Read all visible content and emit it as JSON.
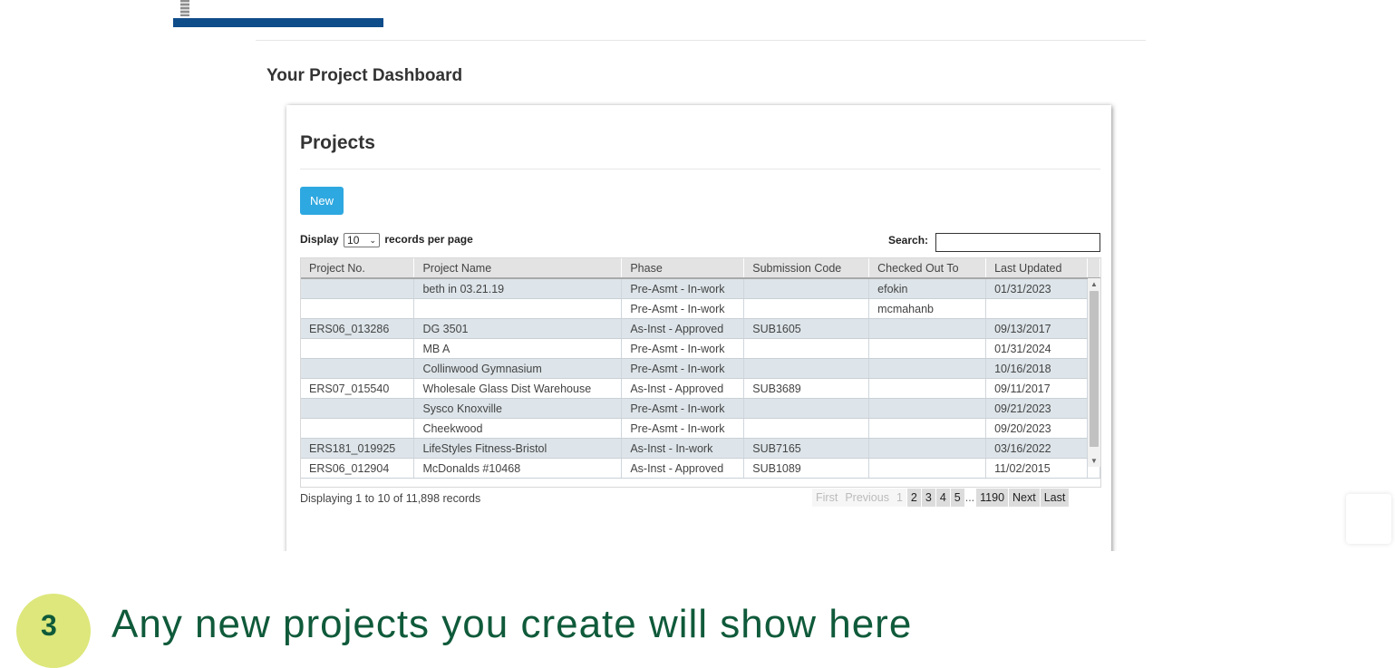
{
  "page_title": "Your Project Dashboard",
  "panel": {
    "title": "Projects",
    "new_label": "New",
    "display_prefix": "Display",
    "records_per_page": "10",
    "display_suffix": "records per page",
    "search_label": "Search:",
    "search_value": ""
  },
  "table": {
    "columns": [
      "Project No.",
      "Project Name",
      "Phase",
      "Submission Code",
      "Checked Out To",
      "Last Updated"
    ],
    "rows": [
      [
        "",
        "beth in 03.21.19",
        "Pre-Asmt - In-work",
        "",
        "efokin",
        "01/31/2023"
      ],
      [
        "",
        "",
        "Pre-Asmt - In-work",
        "",
        "mcmahanb",
        ""
      ],
      [
        "ERS06_013286",
        "DG 3501",
        "As-Inst - Approved",
        "SUB1605",
        "",
        "09/13/2017"
      ],
      [
        "",
        "MB A",
        "Pre-Asmt - In-work",
        "",
        "",
        "01/31/2024"
      ],
      [
        "",
        "Collinwood Gymnasium",
        "Pre-Asmt - In-work",
        "",
        "",
        "10/16/2018"
      ],
      [
        "ERS07_015540",
        "Wholesale Glass Dist Warehouse",
        "As-Inst - Approved",
        "SUB3689",
        "",
        "09/11/2017"
      ],
      [
        "",
        "Sysco Knoxville",
        "Pre-Asmt - In-work",
        "",
        "",
        "09/21/2023"
      ],
      [
        "",
        "Cheekwood",
        "Pre-Asmt - In-work",
        "",
        "",
        "09/20/2023"
      ],
      [
        "ERS181_019925",
        "LifeStyles Fitness-Bristol",
        "As-Inst - In-work",
        "SUB7165",
        "",
        "03/16/2022"
      ],
      [
        "ERS06_012904",
        "McDonalds #10468",
        "As-Inst - Approved",
        "SUB1089",
        "",
        "11/02/2015"
      ]
    ]
  },
  "footer": {
    "info": "Displaying 1 to 10 of 11,898 records",
    "pager": {
      "first": "First",
      "previous": "Previous",
      "current": "1",
      "pages": [
        "2",
        "3",
        "4",
        "5"
      ],
      "ellipsis": "...",
      "last_page": "1190",
      "next": "Next",
      "last": "Last"
    }
  },
  "bottom": {
    "step_number": "3",
    "heading": "Any new projects you create will show here"
  },
  "colors": {
    "new_button": "#2ea8e0",
    "row_odd": "#dde5ea",
    "brand_green": "#0f5a3a",
    "step_circle": "#dde77b",
    "logo_blue": "#0f4c8a"
  }
}
